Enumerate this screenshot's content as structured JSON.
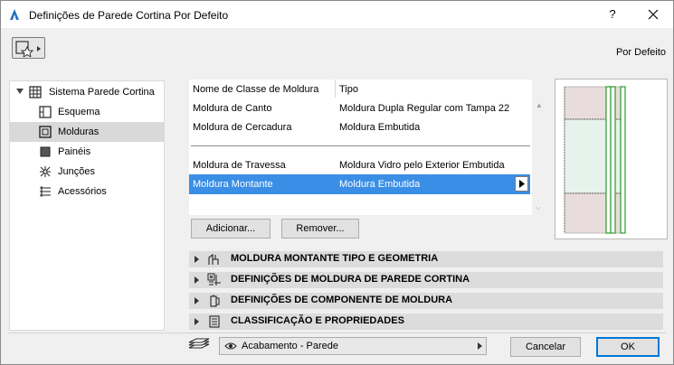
{
  "window": {
    "title": "Definições de Parede Cortina Por Defeito",
    "help_label": "?",
    "close_label": "✕"
  },
  "header": {
    "defaults_label": "Por Defeito"
  },
  "sidebar": {
    "items": [
      {
        "label": "Sistema Parede Cortina",
        "icon": "curtain-wall-system-icon"
      },
      {
        "label": "Esquema",
        "icon": "scheme-icon"
      },
      {
        "label": "Molduras",
        "icon": "frames-icon",
        "selected": true
      },
      {
        "label": "Painéis",
        "icon": "panels-icon"
      },
      {
        "label": "Junções",
        "icon": "junctions-icon"
      },
      {
        "label": "Acessórios",
        "icon": "accessories-icon"
      }
    ]
  },
  "frames_table": {
    "rows": [
      {
        "class": "Nome de Classe de Moldura",
        "type": "Tipo"
      },
      {
        "class": "Moldura de Canto",
        "type": "Moldura Dupla Regular com Tampa 22"
      },
      {
        "class": "Moldura de Cercadura",
        "type": "Moldura Embutida"
      },
      {
        "class": "Moldura de Travessa",
        "type": "Moldura Vidro pelo Exterior Embutida"
      },
      {
        "class": "Moldura Montante",
        "type": "Moldura Embutida",
        "selected": true
      }
    ]
  },
  "buttons": {
    "add": "Adicionar...",
    "remove": "Remover...",
    "cancel": "Cancelar",
    "ok": "OK"
  },
  "sections": [
    {
      "label": "MOLDURA MONTANTE TIPO E GEOMETRIA",
      "icon": "frame-geometry-icon"
    },
    {
      "label": "DEFINIÇÕES DE MOLDURA DE PAREDE CORTINA",
      "icon": "frame-settings-icon"
    },
    {
      "label": "DEFINIÇÕES DE COMPONENTE DE MOLDURA",
      "icon": "frame-component-icon"
    },
    {
      "label": "CLASSIFICAÇÃO E PROPRIEDADES",
      "icon": "classification-icon"
    }
  ],
  "footer": {
    "layer_value": "Acabamento - Parede"
  },
  "colors": {
    "selection": "#3a8ee6",
    "preview_frame": "#2a9a2a",
    "preview_panel": "#e9dcdc",
    "preview_glass": "#e6f2ec"
  }
}
